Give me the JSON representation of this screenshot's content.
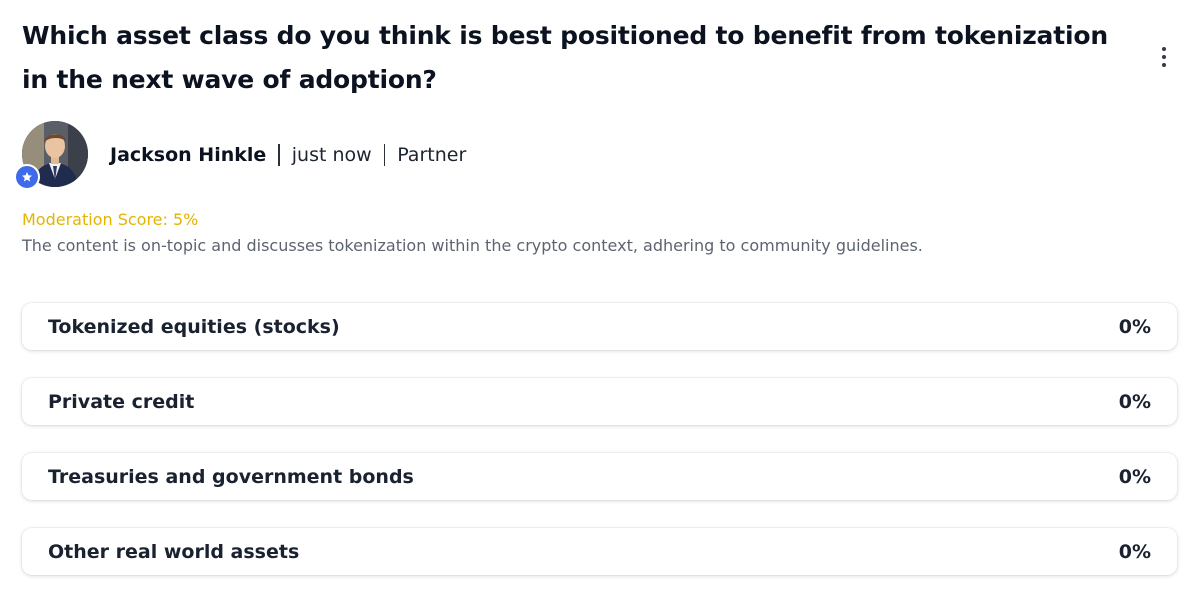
{
  "post": {
    "question": "Which asset class do you think is best positioned to benefit from tokenization in the next wave of adoption?"
  },
  "author": {
    "name": "Jackson Hinkle",
    "time": "just now",
    "role": "Partner"
  },
  "moderation": {
    "score_label": "Moderation Score: 5%",
    "description": "The content is on-topic and discusses tokenization within the crypto context, adhering to community guidelines."
  },
  "poll": {
    "options": [
      {
        "label": "Tokenized equities (stocks)",
        "percent": "0%"
      },
      {
        "label": "Private credit",
        "percent": "0%"
      },
      {
        "label": "Treasuries and government bonds",
        "percent": "0%"
      },
      {
        "label": "Other real world assets",
        "percent": "0%"
      }
    ]
  },
  "icons": {
    "menu": "more-vertical-icon",
    "badge": "star-icon"
  },
  "colors": {
    "moderation_score": "#e3b400",
    "badge": "#3f6ae8",
    "muted_text": "#5d6470"
  }
}
